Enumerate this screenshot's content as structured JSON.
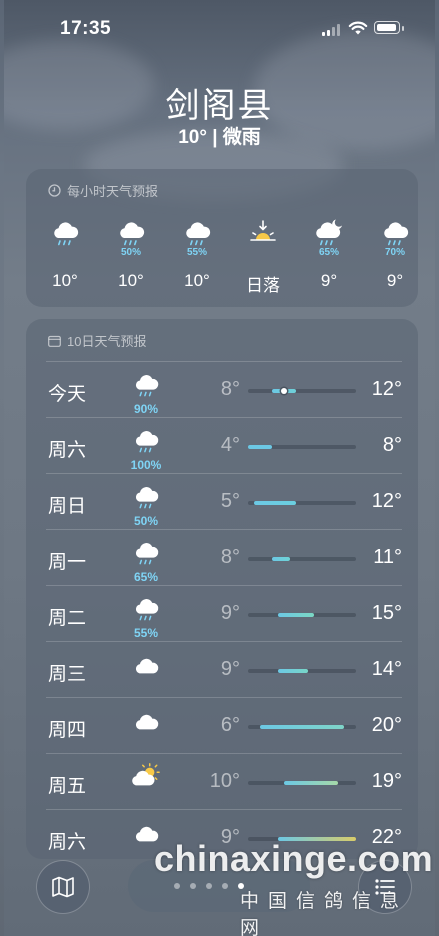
{
  "status": {
    "time": "17:35"
  },
  "header": {
    "city": "剑阁县",
    "condition": "10° | 微雨"
  },
  "hourly": {
    "title": "每小时天气预报",
    "items": [
      {
        "icon": "rain-cloud-icon",
        "precip": "",
        "temp": "10°"
      },
      {
        "icon": "rain-cloud-icon",
        "precip": "50%",
        "temp": "10°"
      },
      {
        "icon": "rain-cloud-icon",
        "precip": "55%",
        "temp": "10°"
      },
      {
        "icon": "sunset-icon",
        "precip": "",
        "temp": "日落"
      },
      {
        "icon": "night-rain-icon",
        "precip": "65%",
        "temp": "9°"
      },
      {
        "icon": "rain-cloud-icon",
        "precip": "70%",
        "temp": "9°"
      }
    ]
  },
  "daily": {
    "title": "10日天气预报",
    "range": [
      4,
      22
    ],
    "items": [
      {
        "day": "今天",
        "icon": "rain-cloud-icon",
        "precip": "90%",
        "low": "8°",
        "high": "12°",
        "lo": 8,
        "hi": 12,
        "current": 10,
        "color": "#6fd0d8"
      },
      {
        "day": "周六",
        "icon": "rain-cloud-icon",
        "precip": "100%",
        "low": "4°",
        "high": "8°",
        "lo": 4,
        "hi": 8,
        "color": "#6cc8e4"
      },
      {
        "day": "周日",
        "icon": "rain-cloud-icon",
        "precip": "50%",
        "low": "5°",
        "high": "12°",
        "lo": 5,
        "hi": 12,
        "color": "#6bcfe0"
      },
      {
        "day": "周一",
        "icon": "rain-cloud-icon",
        "precip": "65%",
        "low": "8°",
        "high": "11°",
        "lo": 8,
        "hi": 11,
        "color": "#6fd3d6"
      },
      {
        "day": "周二",
        "icon": "rain-cloud-icon",
        "precip": "55%",
        "low": "9°",
        "high": "15°",
        "lo": 9,
        "hi": 15,
        "color": "#7bd8c4"
      },
      {
        "day": "周三",
        "icon": "cloud-icon",
        "precip": "",
        "low": "9°",
        "high": "14°",
        "lo": 9,
        "hi": 14,
        "color": "#78d6c8"
      },
      {
        "day": "周四",
        "icon": "cloud-icon",
        "precip": "",
        "low": "6°",
        "high": "20°",
        "lo": 6,
        "hi": 20,
        "color": "#7fd4c8"
      },
      {
        "day": "周五",
        "icon": "partly-sunny-icon",
        "precip": "",
        "low": "10°",
        "high": "19°",
        "lo": 10,
        "hi": 19,
        "color": "#a6d8a8"
      },
      {
        "day": "周六",
        "icon": "cloud-icon",
        "precip": "",
        "low": "9°",
        "high": "22°",
        "lo": 9,
        "hi": 22,
        "color": "#d9cc6a"
      }
    ]
  },
  "watermark": {
    "brand": "chinaxinge.com",
    "cn": "中国信鸽信息网"
  },
  "colors": {
    "precip": "#7fd4f5",
    "sun": "#f7c948"
  }
}
